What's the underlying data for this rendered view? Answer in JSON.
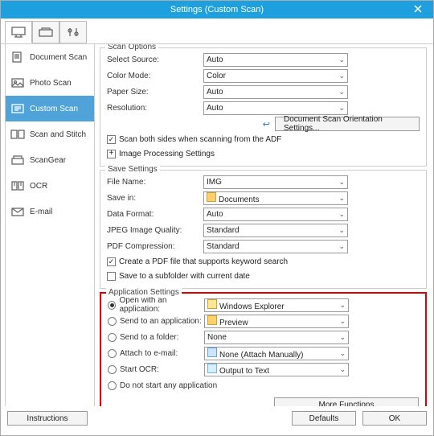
{
  "title": "Settings (Custom Scan)",
  "sidebar": {
    "items": [
      {
        "label": "Document Scan"
      },
      {
        "label": "Photo Scan"
      },
      {
        "label": "Custom Scan"
      },
      {
        "label": "Scan and Stitch"
      },
      {
        "label": "ScanGear"
      },
      {
        "label": "OCR"
      },
      {
        "label": "E-mail"
      }
    ]
  },
  "scan_options": {
    "legend": "Scan Options",
    "select_source_label": "Select Source:",
    "select_source_value": "Auto",
    "color_mode_label": "Color Mode:",
    "color_mode_value": "Color",
    "paper_size_label": "Paper Size:",
    "paper_size_value": "Auto",
    "resolution_label": "Resolution:",
    "resolution_value": "Auto",
    "orientation_btn": "Document Scan Orientation Settings...",
    "scan_both_label": "Scan both sides when scanning from the ADF",
    "img_proc_label": "Image Processing Settings"
  },
  "save_settings": {
    "legend": "Save Settings",
    "file_name_label": "File Name:",
    "file_name_value": "IMG",
    "save_in_label": "Save in:",
    "save_in_value": "Documents",
    "data_format_label": "Data Format:",
    "data_format_value": "Auto",
    "jpeg_label": "JPEG Image Quality:",
    "jpeg_value": "Standard",
    "pdf_comp_label": "PDF Compression:",
    "pdf_comp_value": "Standard",
    "create_pdf_label": "Create a PDF file that supports keyword search",
    "subfolder_label": "Save to a subfolder with current date"
  },
  "app_settings": {
    "legend": "Application Settings",
    "open_with_label": "Open with an application:",
    "open_with_value": "Windows Explorer",
    "send_app_label": "Send to an application:",
    "send_app_value": "Preview",
    "send_folder_label": "Send to a folder:",
    "send_folder_value": "None",
    "attach_label": "Attach to e-mail:",
    "attach_value": "None (Attach Manually)",
    "ocr_label": "Start OCR:",
    "ocr_value": "Output to Text",
    "no_start_label": "Do not start any application",
    "more_fn_btn": "More Functions"
  },
  "footer": {
    "instructions": "Instructions",
    "defaults": "Defaults",
    "ok": "OK"
  }
}
